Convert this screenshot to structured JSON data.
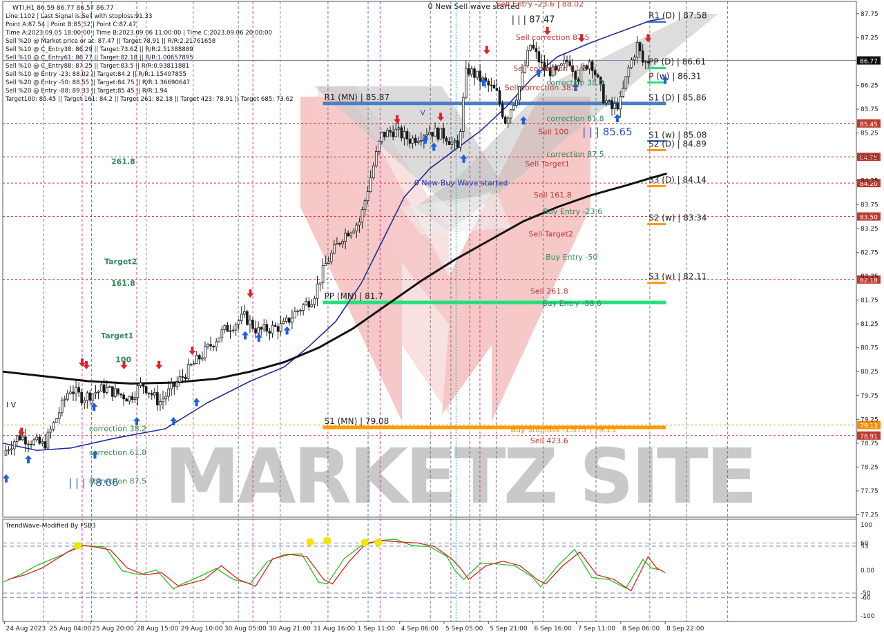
{
  "chart_data": {
    "type": "candlestick",
    "symbol": "WTI,H1",
    "ohlc_header": "86.59 86.77 86.57 86.77",
    "info_lines": [
      "Line:1102 | Last Signal is:Sell with stoploss:91.33",
      "Point A:87.54 | Point B:85.52 | Point C:87.47",
      "Time A:2023.09.05 18:00:00 | Time B:2023.09.06 11:00:00 | Time C:2023.09.06 20:00:00",
      "Sell %20 @ Market price or at: 87.47 || Target:78.91 || R/R:2.21761658",
      "Sell %10 @ C_Entry38: 86.29 || Target:73.62 || R/R:2.51388889",
      "Sell %10 @ C_Entry61: 86.77 || Target:82.18 || R/R:1.00657895",
      "Sell %10 @ C_Entry88: 87.25 || Target:83.5 || R/R:0.93811881",
      "Sell %10 @ Entry -23: 88.02 || Target:84.2 || R/R:1.15407855",
      "Sell %20 @ Entry -50: 88.55 || Target:84.75 || R/R:1.36690647",
      "Sell %20 @ Entry -88: 89.33 || Target:85.45 || R/R:1.94",
      "Target100: 85.45 || Target 161: 84.2 || Target 261: 82.18 || Target 423: 78.91 || Target 685: 73.62"
    ],
    "price_ticks": [
      "87.75",
      "87.25",
      "86.75",
      "86.25",
      "85.75",
      "85.25",
      "84.75",
      "84.25",
      "83.75",
      "83.25",
      "82.75",
      "82.25",
      "81.75",
      "81.25",
      "80.75",
      "80.25",
      "79.75",
      "79.25",
      "78.75",
      "78.25",
      "77.75",
      "77.25"
    ],
    "price_tick_values": [
      87.75,
      87.25,
      86.75,
      86.25,
      85.75,
      85.25,
      84.75,
      84.25,
      83.75,
      83.25,
      82.75,
      82.25,
      81.75,
      81.25,
      80.75,
      80.25,
      79.75,
      79.25,
      78.75,
      78.25,
      77.75,
      77.25
    ],
    "ylim": [
      77.2,
      87.95
    ],
    "current_price": {
      "label": "86.77",
      "value": 86.77
    },
    "date_labels": [
      "24 Aug 2023",
      "25 Aug 04:00",
      "25 Aug 20:00",
      "28 Aug 15:00",
      "29 Aug 10:00",
      "30 Aug 05:00",
      "30 Aug 21:00",
      "31 Aug 16:00",
      "1 Sep 11:00",
      "4 Sep 06:00",
      "5 Sep 05:00",
      "5 Sep 21:00",
      "6 Sep 16:00",
      "7 Sep 11:00",
      "8 Sep 06:00",
      "8 Sep 22:00"
    ],
    "target_levels": [
      {
        "label": "85.45",
        "value": 85.45,
        "color": "#c0392b"
      },
      {
        "label": "84.75",
        "value": 84.75,
        "color": "#c0392b"
      },
      {
        "label": "84.20",
        "value": 84.2,
        "color": "#c0392b"
      },
      {
        "label": "83.50",
        "value": 83.5,
        "color": "#c0392b"
      },
      {
        "label": "82.18",
        "value": 82.18,
        "color": "#c0392b"
      },
      {
        "label": "79.13",
        "value": 79.13,
        "color": "#ff8c00"
      },
      {
        "label": "78.91",
        "value": 78.91,
        "color": "#c0392b"
      }
    ],
    "pivots": [
      {
        "label": "R1 (MN) | 85.87",
        "value": 85.87,
        "color": "#4a7fc0",
        "x0": 0.375,
        "x1": 0.777
      },
      {
        "label": "PP (MN) | 81.7",
        "value": 81.7,
        "color": "#22e07a",
        "x0": 0.375,
        "x1": 0.777
      },
      {
        "label": "S1 (MN) | 79.08",
        "value": 79.08,
        "color": "#ff9900",
        "x0": 0.375,
        "x1": 0.777
      },
      {
        "label": "R1 (D) | 87.58",
        "value": 87.58,
        "color": "#4a7fc0",
        "x0": 0.755,
        "x1": 0.777
      },
      {
        "label": "PP (D) | 86.61",
        "value": 86.61,
        "color": "#22e07a",
        "x0": 0.755,
        "x1": 0.777
      },
      {
        "label": "S1 (D) | 85.86",
        "value": 85.86,
        "color": "#4a7fc0",
        "x0": 0.755,
        "x1": 0.777
      },
      {
        "label": "S1 (w) | 85.08",
        "value": 85.08,
        "color": "#4a7fc0",
        "x0": 0.755,
        "x1": 0.777
      },
      {
        "label": "S2 (D) | 84.89",
        "value": 84.89,
        "color": "#ff9900",
        "x0": 0.755,
        "x1": 0.777
      },
      {
        "label": "S3 (D) | 84.14",
        "value": 84.14,
        "color": "#ff9900",
        "x0": 0.755,
        "x1": 0.777
      },
      {
        "label": "S2 (w) | 83.34",
        "value": 83.34,
        "color": "#ff9900",
        "x0": 0.755,
        "x1": 0.777
      },
      {
        "label": "S3 (w) | 82.11",
        "value": 82.11,
        "color": "#ff9900",
        "x0": 0.755,
        "x1": 0.777
      },
      {
        "label": "P (w) | 86.31",
        "value": 86.31,
        "color": "#22e07a",
        "x0": 0.755,
        "x1": 0.777
      }
    ],
    "annotations": [
      {
        "text": "0 New Sell wave started",
        "x": 0.498,
        "value": 87.85,
        "color": "#222"
      },
      {
        "text": "| | | 87.47",
        "x": 0.596,
        "value": 87.57,
        "color": "#222",
        "size": 13
      },
      {
        "text": "Sell Entry -23.6 | 88.02",
        "x": 0.578,
        "value": 87.9,
        "color": "#c0392b"
      },
      {
        "text": "Sell correction 87.5",
        "x": 0.601,
        "value": 87.2,
        "color": "#c0392b"
      },
      {
        "text": "Sell correction 61.8",
        "x": 0.598,
        "value": 86.55,
        "color": "#c0392b"
      },
      {
        "text": "Sell correction 38.2",
        "x": 0.588,
        "value": 86.15,
        "color": "#c0392b"
      },
      {
        "text": "correction 38.2",
        "x": 0.637,
        "value": 86.25,
        "color": "#2e8b57"
      },
      {
        "text": "correction 61.8",
        "x": 0.637,
        "value": 85.5,
        "color": "#2e8b57"
      },
      {
        "text": "| | | 85.65",
        "x": 0.679,
        "value": 85.2,
        "color": "#3050c0",
        "size": 15
      },
      {
        "text": "Sell 100",
        "x": 0.627,
        "value": 85.22,
        "color": "#c0392b"
      },
      {
        "text": "correction 87.5",
        "x": 0.637,
        "value": 84.75,
        "color": "#2e8b57"
      },
      {
        "text": "Sell Target1",
        "x": 0.612,
        "value": 84.55,
        "color": "#c0392b"
      },
      {
        "text": "0 New Buy Wave started",
        "x": 0.482,
        "value": 84.15,
        "color": "#3030c0"
      },
      {
        "text": "Sell 161.8",
        "x": 0.622,
        "value": 83.9,
        "color": "#c0392b"
      },
      {
        "text": "Buy Entry -23.6",
        "x": 0.633,
        "value": 83.55,
        "color": "#2e8b57"
      },
      {
        "text": "Sell Target2",
        "x": 0.616,
        "value": 83.08,
        "color": "#c0392b"
      },
      {
        "text": "Buy Entry -50",
        "x": 0.636,
        "value": 82.6,
        "color": "#2e8b57"
      },
      {
        "text": "Sell 261.8",
        "x": 0.618,
        "value": 81.88,
        "color": "#c0392b"
      },
      {
        "text": "Buy Entry -88.6",
        "x": 0.632,
        "value": 81.63,
        "color": "#2e8b57"
      },
      {
        "text": "Buy Stoploss -1.875 | 79.13",
        "x": 0.595,
        "value": 78.98,
        "color": "#ff8c00"
      },
      {
        "text": "Sell 423.6",
        "x": 0.618,
        "value": 78.75,
        "color": "#c0392b"
      },
      {
        "text": "261.8",
        "x": 0.127,
        "value": 84.6,
        "color": "#2e8b57",
        "bold": true
      },
      {
        "text": "Target2",
        "x": 0.119,
        "value": 82.5,
        "color": "#2e8b57",
        "bold": true
      },
      {
        "text": "161.8",
        "x": 0.127,
        "value": 82.05,
        "color": "#2e8b57",
        "bold": true
      },
      {
        "text": "Target1",
        "x": 0.115,
        "value": 80.95,
        "color": "#2e8b57",
        "bold": true
      },
      {
        "text": "100",
        "x": 0.132,
        "value": 80.45,
        "color": "#2e8b57",
        "bold": true
      },
      {
        "text": "correction 38.2",
        "x": 0.101,
        "value": 79.0,
        "color": "#2e8b57"
      },
      {
        "text": "correction 61.8",
        "x": 0.101,
        "value": 78.5,
        "color": "#2e8b57"
      },
      {
        "text": "| | | 78.06",
        "x": 0.077,
        "value": 77.85,
        "color": "#3050c0",
        "size": 15
      },
      {
        "text": "correction 87.5",
        "x": 0.101,
        "value": 77.9,
        "color": "#2e8b57"
      },
      {
        "text": "I V",
        "x": 0.004,
        "value": 79.5,
        "color": "#222"
      },
      {
        "text": "V",
        "x": 0.489,
        "value": 85.62,
        "color": "#3050c0"
      }
    ],
    "indicator": {
      "title": "TrendWave-Modified By FSB3",
      "ticks": [
        "100",
        "60",
        "53",
        "0.00",
        "-50",
        "-60",
        "-100"
      ],
      "tick_values": [
        100,
        60,
        53,
        0,
        -50,
        -60,
        -100
      ],
      "ylim": [
        -112,
        112
      ]
    },
    "watermark": "MARKETZ SITE"
  }
}
